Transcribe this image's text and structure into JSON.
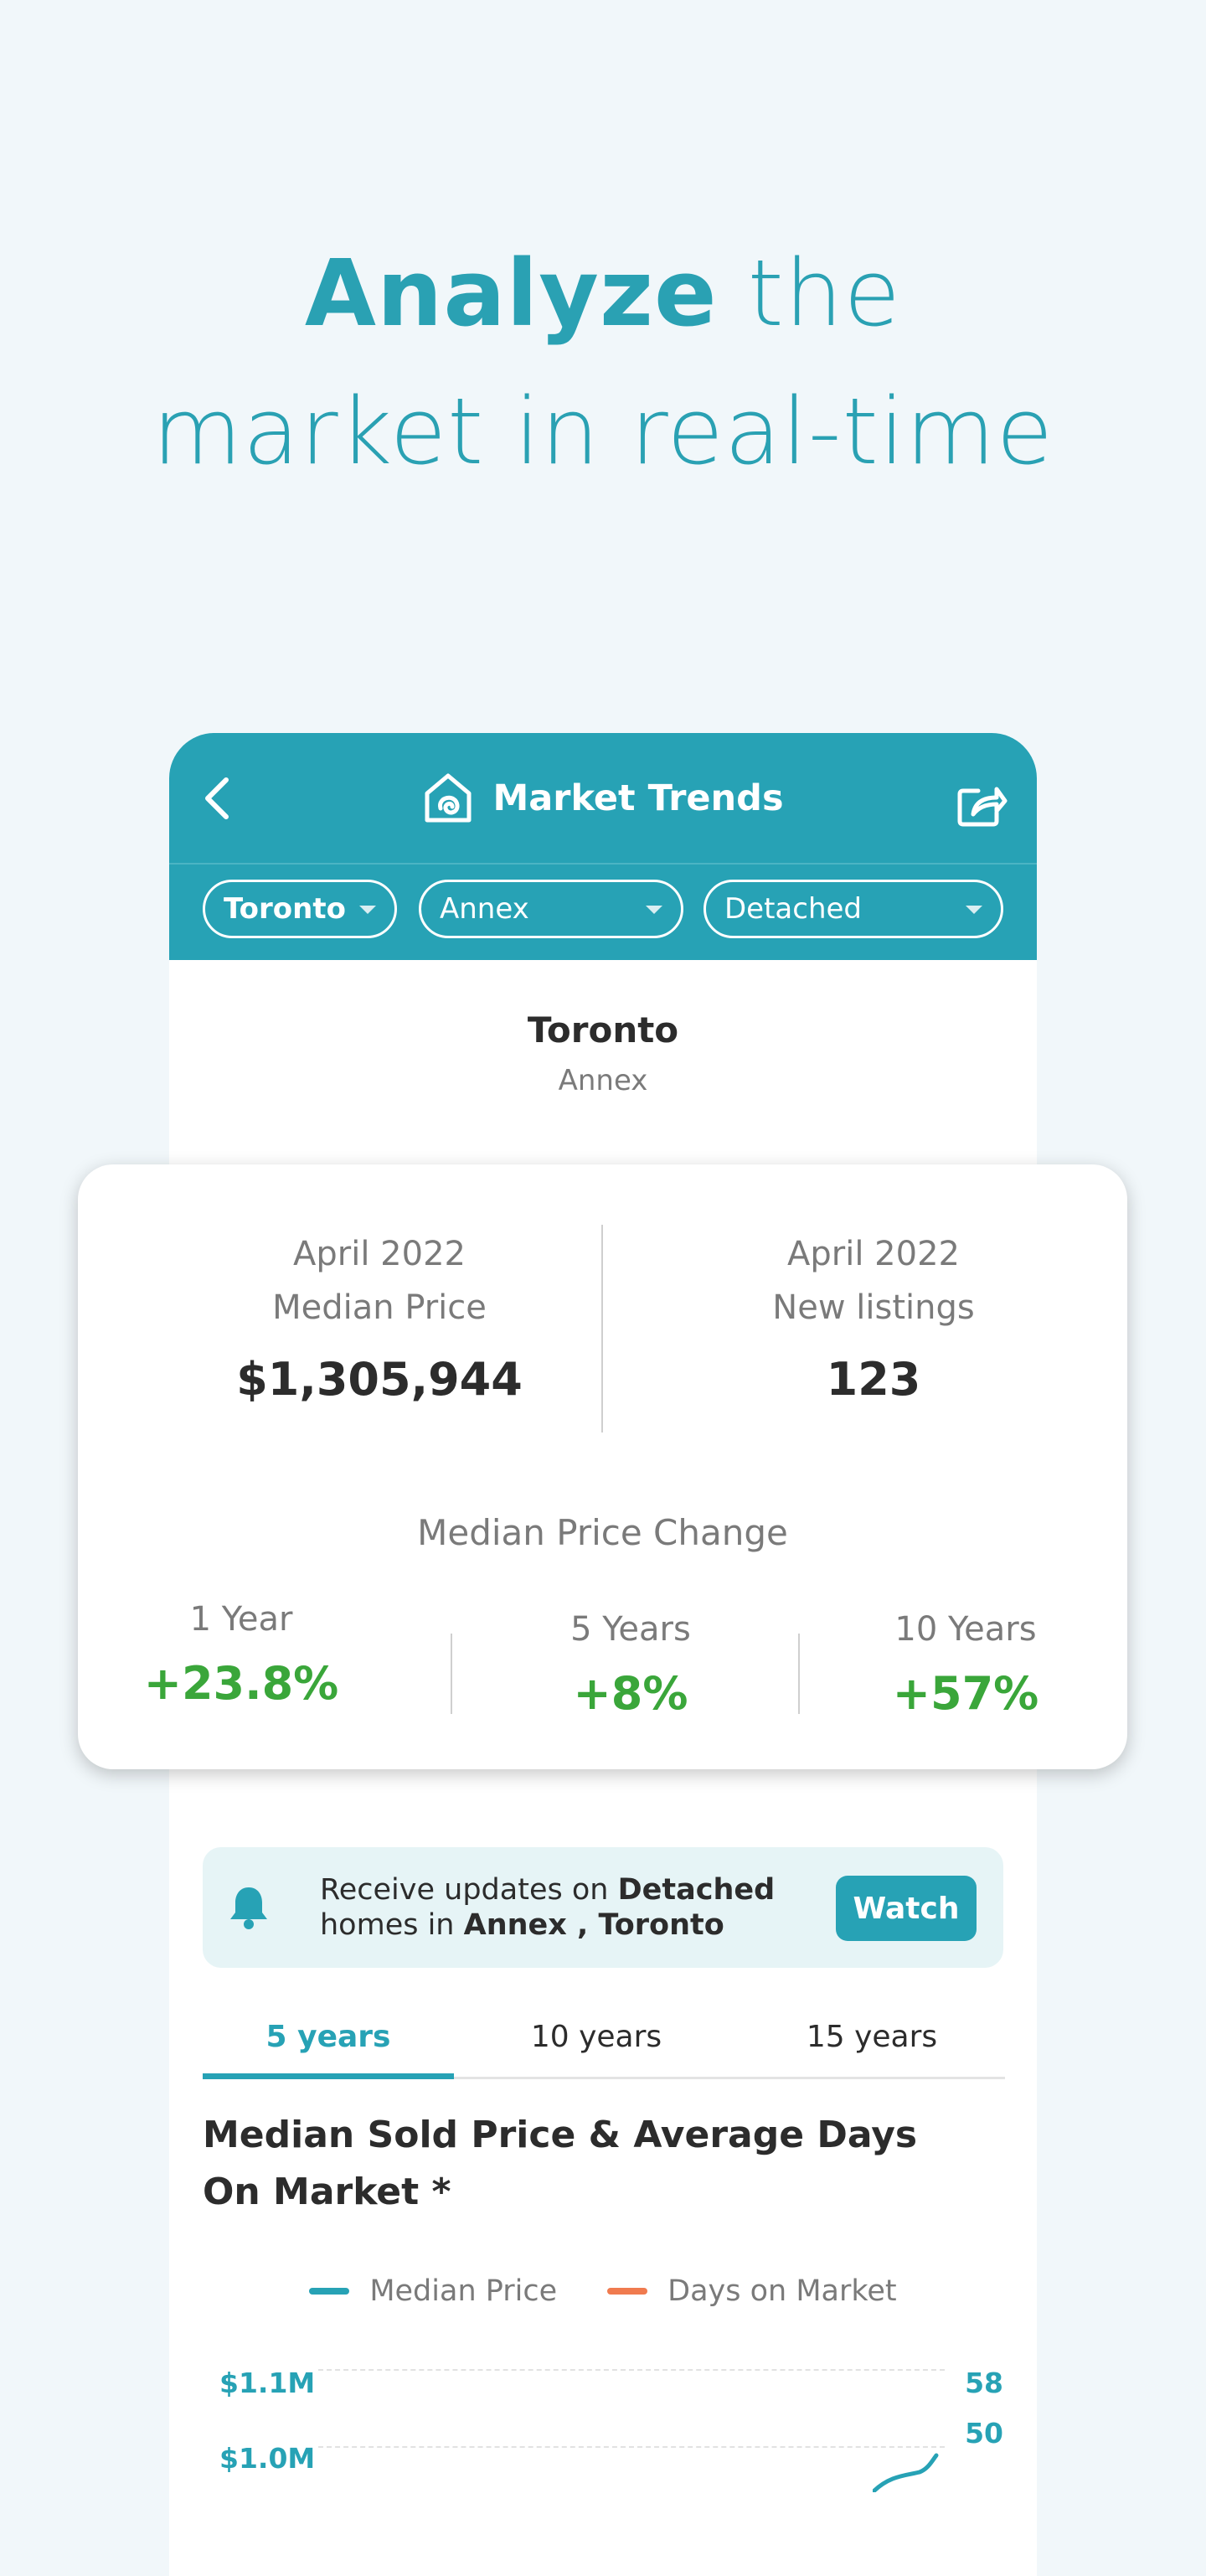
{
  "hero": {
    "bold": "Analyze",
    "line1_rest": " the",
    "line2": "market in real-time"
  },
  "app": {
    "title": "Market Trends",
    "filters": {
      "city": "Toronto",
      "neighbourhood": "Annex",
      "property_type": "Detached"
    },
    "location": {
      "city": "Toronto",
      "neighbourhood": "Annex"
    }
  },
  "stats": {
    "left": {
      "period": "April 2022",
      "label": "Median Price",
      "value": "$1,305,944"
    },
    "right": {
      "period": "April 2022",
      "label": "New listings",
      "value": "123"
    },
    "change_title": "Median Price Change",
    "changes": [
      {
        "label": "1 Year",
        "value": "+23.8%"
      },
      {
        "label": "5 Years",
        "value": "+8%"
      },
      {
        "label": "10 Years",
        "value": "+57%"
      }
    ]
  },
  "notice": {
    "prefix": "Receive updates on ",
    "type": "Detached",
    "middle": "homes in ",
    "area": "Annex , Toronto",
    "button": "Watch"
  },
  "tabs": [
    "5 years",
    "10 years",
    "15 years"
  ],
  "chart": {
    "title": "Median Sold Price & Average Days On Market *",
    "legend": [
      "Median Price",
      "Days on Market"
    ],
    "left_ticks": [
      "$1.1M",
      "$1.0M"
    ],
    "right_ticks": [
      "58",
      "50"
    ]
  },
  "chart_data": {
    "type": "line",
    "title": "Median Sold Price & Average Days On Market *",
    "series": [
      {
        "name": "Median Price",
        "color": "#27a2b5"
      },
      {
        "name": "Days on Market",
        "color": "#f07b4f"
      }
    ],
    "left_axis_ticks": [
      "$1.1M",
      "$1.0M"
    ],
    "right_axis_ticks": [
      58,
      50
    ]
  },
  "colors": {
    "brand": "#27a2b5",
    "positive": "#3aa63a",
    "accent_orange": "#f07b4f"
  }
}
